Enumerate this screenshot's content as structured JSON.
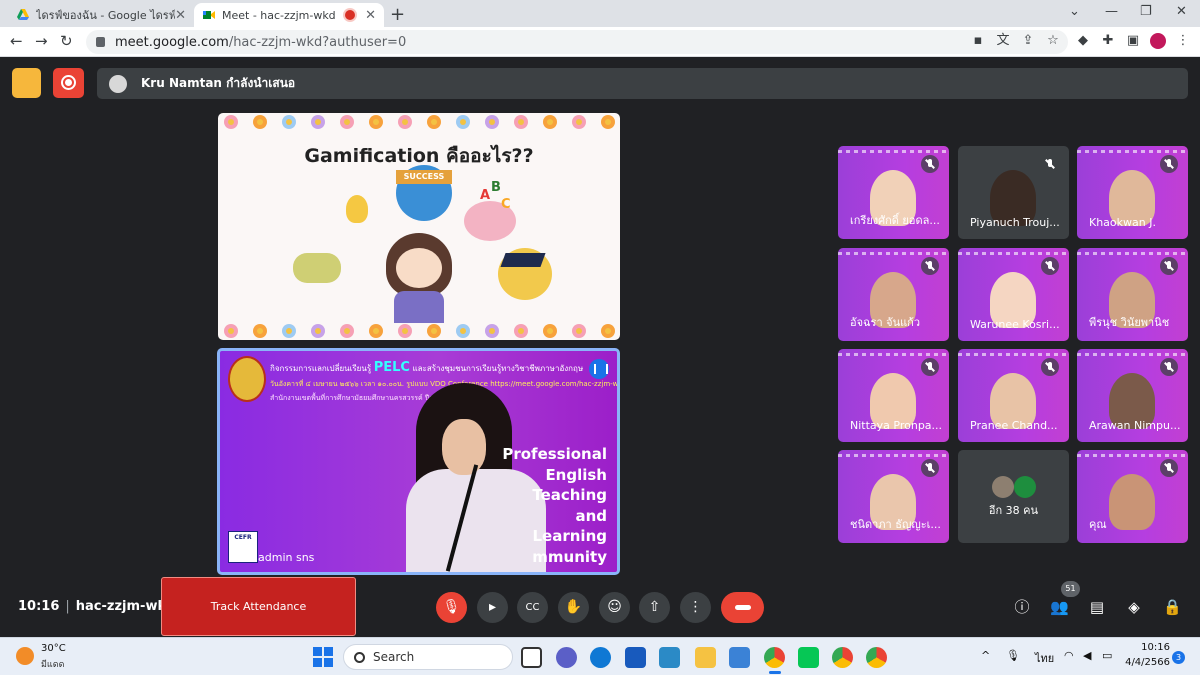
{
  "browser": {
    "tabs": [
      {
        "title": "ไดรฟ์ของฉัน - Google ไดรฟ์",
        "active": false
      },
      {
        "title": "Meet - hac-zzjm-wkd",
        "active": true
      }
    ],
    "url_host": "meet.google.com",
    "url_path": "/hac-zzjm-wkd?authuser=0"
  },
  "meet": {
    "presenting_text": "Kru Namtan กำลังนำเสนอ",
    "slide": {
      "title": "Gamification คืออะไร??",
      "sign": "SUCCESS",
      "abc": [
        "A",
        "B",
        "C"
      ]
    },
    "speaker_tile": {
      "banner_line1_prefix": "กิจกรรมการแลกเปลี่ยนเรียนรู้",
      "banner_brand": "PELC",
      "banner_line1_suffix": "และสร้างชุมชนการเรียนรู้ทางวิชาชีพภาษาอังกฤษ",
      "banner_line2": "วันอังคารที่ ๔ เมษายน ๒๕๖๖ เวลา ๑๐.๐๐น. รูปแบบ VDO Conference https://meet.google.com/hac-zzjm-wkd",
      "banner_line3": "สำนักงานเขตพื้นที่การศึกษามัธยมศึกษานครสวรรค์ ปีการศึกษา ๒๕๖๖",
      "pe_lines": [
        "Professional",
        "English",
        "Teaching",
        "and",
        "Learning",
        "mmunity"
      ],
      "cefr": "CEFR",
      "name": "admin sns"
    },
    "participants": [
      {
        "name": "เกรียงศักดิ์ ยอดล...",
        "style": "purple"
      },
      {
        "name": "Piyanuch Trouj...",
        "style": "dark"
      },
      {
        "name": "Khaokwan J.",
        "style": "purple"
      },
      {
        "name": "อัจฉรา จันแก้ว",
        "style": "purple"
      },
      {
        "name": "Warunee Kosri...",
        "style": "purple"
      },
      {
        "name": "พีรนุช วินัยพานิช",
        "style": "purple"
      },
      {
        "name": "Nittaya Pronpa...",
        "style": "purple"
      },
      {
        "name": "Pranee Chand...",
        "style": "purple"
      },
      {
        "name": "Arawan Nimpu...",
        "style": "purple"
      },
      {
        "name": "ชนิดาภา ธัญญะเ...",
        "style": "purple"
      },
      {
        "name": "อีก 38 คน",
        "style": "dark"
      },
      {
        "name": "คุณ",
        "style": "purple"
      }
    ],
    "time": "10:16",
    "meeting_code": "hac-zzjm-wkd",
    "track_attendance": "Track Attendance",
    "participant_count": "51"
  },
  "taskbar": {
    "temperature": "30°C",
    "weather": "มีแดด",
    "search_label": "Search",
    "language": "ไทย",
    "clock_time": "10:16",
    "clock_date": "4/4/2566",
    "notifications": "3"
  }
}
